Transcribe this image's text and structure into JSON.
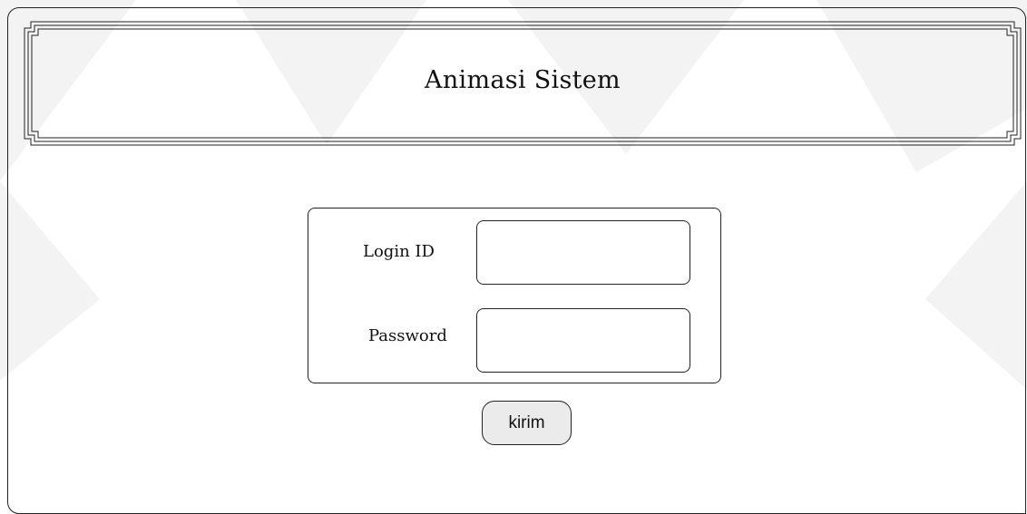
{
  "header": {
    "title": "Animasi Sistem"
  },
  "login_form": {
    "login_label": "Login ID",
    "login_value": "",
    "password_label": "Password",
    "password_value": ""
  },
  "actions": {
    "submit_label": "kirim"
  },
  "colors": {
    "border": "#222222",
    "button_fill": "#ebebeb",
    "background": "#ffffff",
    "watermark": "#f2f2f2"
  }
}
